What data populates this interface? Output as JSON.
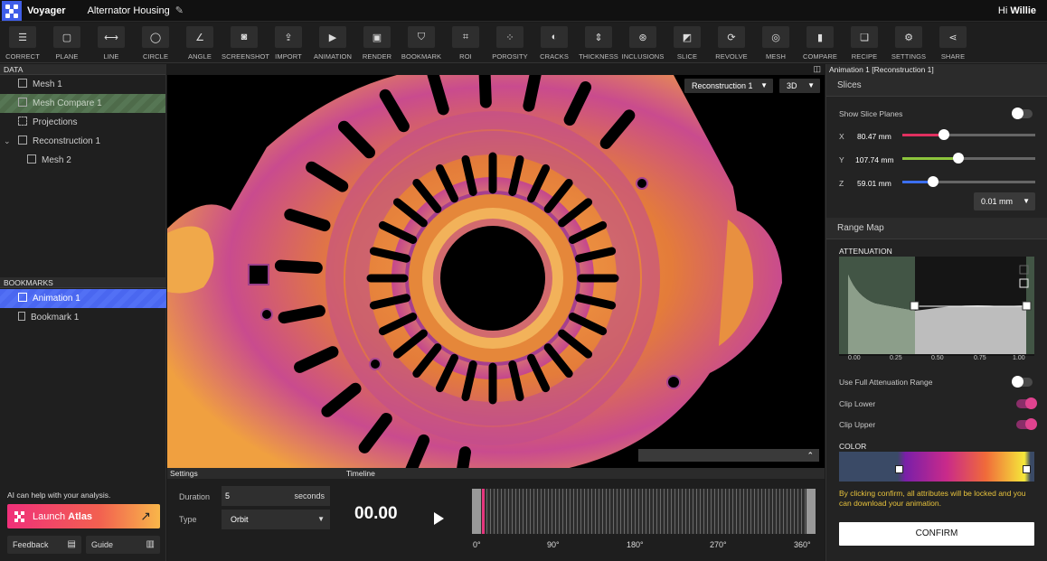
{
  "app": {
    "name": "Voyager",
    "project": "Alternator Housing",
    "greeting": "Hi",
    "user": "Willie"
  },
  "tools": [
    {
      "label": "CORRECT",
      "icon": "sliders-icon",
      "glyph": "☰"
    },
    {
      "label": "PLANE",
      "icon": "plane-icon",
      "glyph": "▢"
    },
    {
      "label": "LINE",
      "icon": "line-icon",
      "glyph": "⟷"
    },
    {
      "label": "CIRCLE",
      "icon": "circle-icon",
      "glyph": "◯"
    },
    {
      "label": "ANGLE",
      "icon": "angle-icon",
      "glyph": "∠"
    },
    {
      "label": "SCREENSHOT",
      "icon": "camera-icon",
      "glyph": "◙"
    },
    {
      "label": "IMPORT",
      "icon": "upload-icon",
      "glyph": "⇪"
    },
    {
      "label": "ANIMATION",
      "icon": "play-square-icon",
      "glyph": "▶"
    },
    {
      "label": "RENDER",
      "icon": "image-icon",
      "glyph": "▣"
    },
    {
      "label": "BOOKMARK",
      "icon": "bookmark-icon",
      "glyph": "⛉"
    },
    {
      "label": "ROI",
      "icon": "crop-icon",
      "glyph": "⌗"
    },
    {
      "label": "POROSITY",
      "icon": "porosity-icon",
      "glyph": "⁘"
    },
    {
      "label": "CRACKS",
      "icon": "cracks-icon",
      "glyph": "◐"
    },
    {
      "label": "THICKNESS",
      "icon": "thickness-icon",
      "glyph": "⇕"
    },
    {
      "label": "INCLUSIONS",
      "icon": "inclusions-icon",
      "glyph": "⊛"
    },
    {
      "label": "SLICE",
      "icon": "slice-icon",
      "glyph": "◩"
    },
    {
      "label": "REVOLVE",
      "icon": "revolve-icon",
      "glyph": "⟳"
    },
    {
      "label": "MESH",
      "icon": "mesh-icon",
      "glyph": "◎"
    },
    {
      "label": "COMPARE",
      "icon": "compare-icon",
      "glyph": "▮"
    },
    {
      "label": "RECIPE",
      "icon": "recipe-icon",
      "glyph": "❏"
    },
    {
      "label": "SETTINGS",
      "icon": "gear-icon",
      "glyph": "⚙"
    },
    {
      "label": "SHARE",
      "icon": "share-icon",
      "glyph": "⋖"
    }
  ],
  "data_panel": {
    "header": "DATA",
    "items": [
      {
        "label": "Mesh 1",
        "icon": "mesh-icon"
      },
      {
        "label": "Mesh Compare 1",
        "icon": "compare-icon"
      },
      {
        "label": "Projections",
        "icon": "projection-icon"
      },
      {
        "label": "Reconstruction 1",
        "icon": "cube-icon"
      },
      {
        "label": "Mesh 2",
        "icon": "mesh-icon"
      }
    ]
  },
  "bookmarks_panel": {
    "header": "BOOKMARKS",
    "items": [
      {
        "label": "Animation 1",
        "icon": "play-square-icon"
      },
      {
        "label": "Bookmark 1",
        "icon": "bookmark-icon"
      }
    ]
  },
  "ai": {
    "text": "AI can help with your analysis.",
    "launch_prefix": "Launch",
    "launch_name": "Atlas"
  },
  "footer": {
    "feedback": "Feedback",
    "guide": "Guide"
  },
  "viewport": {
    "source": "Reconstruction 1",
    "view_mode": "3D"
  },
  "settings": {
    "header": "Settings",
    "duration_label": "Duration",
    "duration_value": "5",
    "duration_unit": "seconds",
    "type_label": "Type",
    "type_value": "Orbit"
  },
  "timeline": {
    "header": "Timeline",
    "time": "00.00",
    "ticks": [
      "0°",
      "90°",
      "180°",
      "270°",
      "360°"
    ],
    "progress": 0
  },
  "right": {
    "header": "Animation 1 [Reconstruction 1]",
    "slices_title": "Slices",
    "show_slice_planes": "Show Slice Planes",
    "show_slice_planes_on": false,
    "axes": [
      {
        "axis": "X",
        "value": "80.47 mm",
        "fraction": 0.31,
        "color": "#e0305f"
      },
      {
        "axis": "Y",
        "value": "107.74 mm",
        "fraction": 0.42,
        "color": "#8cc43c"
      },
      {
        "axis": "Z",
        "value": "59.01 mm",
        "fraction": 0.23,
        "color": "#3b6ff0"
      }
    ],
    "step": "0.01 mm",
    "range_title": "Range Map",
    "attenuation_label": "ATTENUATION",
    "atten_ticks": [
      "0.00",
      "0.25",
      "0.50",
      "0.75",
      "1.00"
    ],
    "full_range": "Use Full Attenuation Range",
    "full_range_on": false,
    "clip_lower": "Clip Lower",
    "clip_lower_on": true,
    "clip_upper": "Clip Upper",
    "clip_upper_on": true,
    "color_label": "COLOR",
    "note": "By clicking confirm, all attributes will be locked and you can download your animation.",
    "confirm": "CONFIRM"
  }
}
